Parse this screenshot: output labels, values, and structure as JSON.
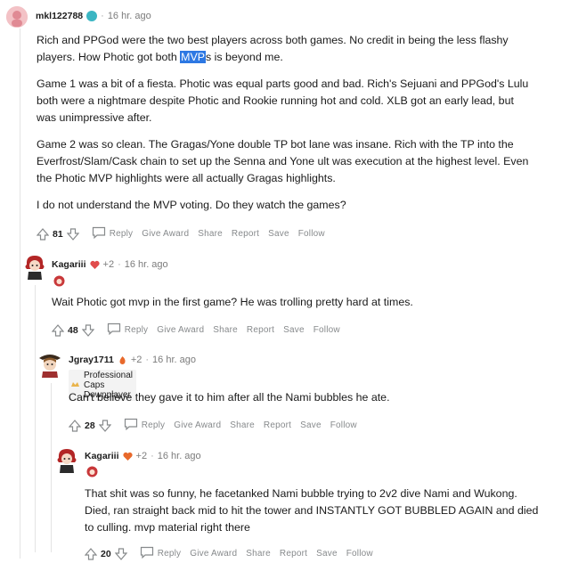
{
  "comments": [
    {
      "user": "mkl122788",
      "time": "16 hr. ago",
      "paragraphs": [
        [
          "Rich and PPGod were the two best players across both games. No credit in being the less flashy",
          "players. How Photic got both ",
          "MVP",
          "s is beyond me."
        ],
        [
          "Game 1 was a bit of a fiesta. Photic was equal parts good and bad. Rich's Sejuani and PPGod's Lulu",
          "both were a nightmare despite Photic and Rookie running hot and cold. XLB got an early lead, but",
          "was unimpressive after."
        ],
        [
          "Game 2 was so clean. The Gragas/Yone double TP bot lane was insane. Rich with the TP into the",
          "Everfrost/Slam/Cask chain to set up the Senna and Yone ult was execution at the highest level. Even",
          "the Photic MVP highlights were all actually Gragas highlights."
        ],
        [
          "I do not understand the MVP voting. Do they watch the games?"
        ]
      ],
      "score": "81"
    },
    {
      "user": "Kagariii",
      "award_count": "+2",
      "time": "16 hr. ago",
      "text": "Wait Photic got mvp in the first game? He was trolling pretty hard at times.",
      "score": "48"
    },
    {
      "user": "Jgray1711",
      "award_count": "+2",
      "time": "16 hr. ago",
      "flair": "Professional Caps Downplayer",
      "text": "Can't believe they gave it to him after all the Nami bubbles he ate.",
      "score": "28"
    },
    {
      "user": "Kagariii",
      "award_count": "+2",
      "time": "16 hr. ago",
      "lines": [
        "That shit was so funny, he facetanked Nami bubble trying to 2v2 dive Nami and Wukong.",
        "Died, ran straight back mid to hit the tower and INSTANTLY GOT BUBBLED AGAIN and died",
        "to culling. mvp material right there"
      ],
      "score": "20"
    }
  ],
  "actions": {
    "reply": "Reply",
    "give_award": "Give Award",
    "share": "Share",
    "report": "Report",
    "save": "Save",
    "follow": "Follow"
  },
  "separator": "·",
  "colors": {
    "highlight": "#2d78e3",
    "meta_text": "#7c7c7c",
    "thread_line": "#e4e4e4"
  },
  "icons": {
    "upvote": "upvote-arrow-icon",
    "downvote": "downvote-arrow-icon",
    "reply": "speech-bubble-icon",
    "award": "award-icon"
  }
}
